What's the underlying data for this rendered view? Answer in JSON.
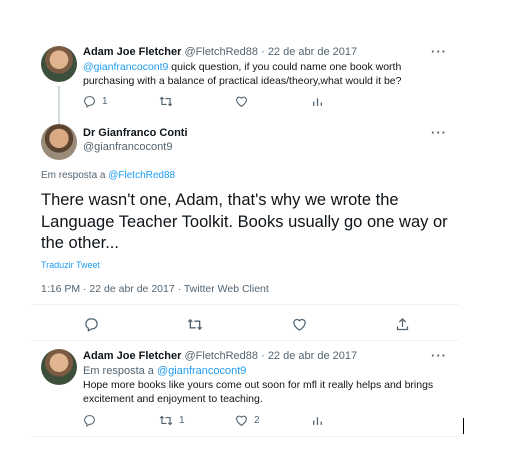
{
  "tweets": {
    "first": {
      "name": "Adam Joe Fletcher",
      "handle": "@FletchRed88",
      "date": "· 22 de abr de 2017",
      "mention": "@gianfrancocont9",
      "text_rest": " quick question, if you could name one book worth purchasing with a balance of practical ideas/theory,what would it be?",
      "reply_count": "1"
    },
    "main": {
      "name": "Dr Gianfranco Conti",
      "handle": "@gianfrancocont9",
      "reply_prefix": "Em resposta a ",
      "reply_to": "@FletchRed88",
      "text": "There wasn't one, Adam, that's why we wrote the Language Teacher Toolkit. Books usually go one way or the other...",
      "translate": "Traduzir Tweet",
      "meta": "1:16 PM · 22 de abr de 2017 · Twitter Web Client"
    },
    "reply": {
      "name": "Adam Joe Fletcher",
      "handle": "@FletchRed88",
      "date": "· 22 de abr de 2017",
      "reply_prefix": "Em resposta a ",
      "reply_to": "@gianfrancocont9",
      "text": "Hope more books like yours come out soon for mfl it really helps and brings excitement and enjoyment to teaching.",
      "retweet_count": "1",
      "like_count": "2"
    }
  },
  "more_label": "···",
  "colors": {
    "accent": "#1d9bf0",
    "muted": "#536471",
    "text": "#0f1419"
  }
}
